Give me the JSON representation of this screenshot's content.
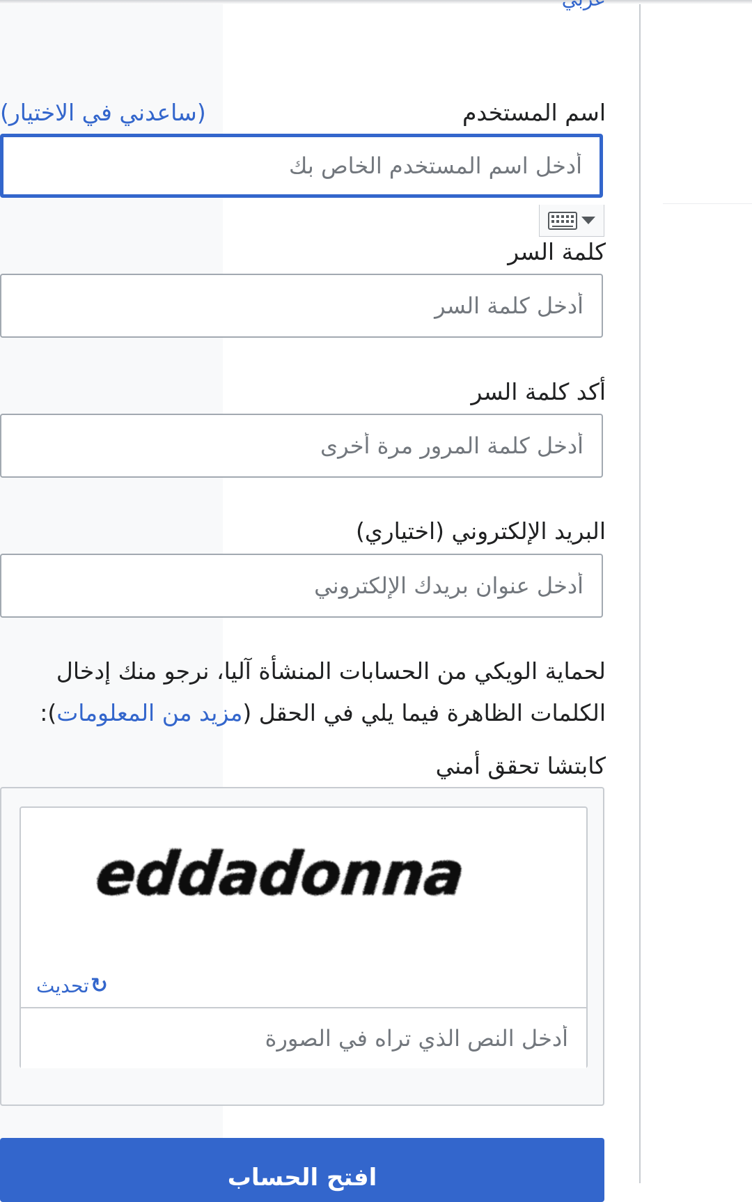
{
  "header": {
    "language_link": "عربي"
  },
  "form": {
    "username": {
      "label": "اسم المستخدم",
      "help_link": "(ساعدني في الاختيار)",
      "placeholder": "أدخل اسم المستخدم الخاص بك"
    },
    "password": {
      "label": "كلمة السر",
      "placeholder": "أدخل كلمة السر"
    },
    "confirm_password": {
      "label": "أكد كلمة السر",
      "placeholder": "أدخل كلمة المرور مرة أخرى"
    },
    "email": {
      "label": "البريد الإلكتروني (اختياري)",
      "placeholder": "أدخل عنوان بريدك الإلكتروني"
    },
    "captcha_notice": {
      "text_before": "لحماية الويكي من الحسابات المنشأة آليا، نرجو منك إدخال الكلمات الظاهرة فيما يلي في الحقل (",
      "link": "مزيد من المعلومات",
      "text_after": "):"
    },
    "captcha": {
      "label": "كابتشا تحقق أمني",
      "image_text": "eddadonna",
      "refresh_label": "تحديث",
      "placeholder": "أدخل النص الذي تراه في الصورة"
    },
    "submit_label": "افتح الحساب"
  },
  "icons": {
    "keyboard": "keyboard-icon",
    "dropdown": "caret-down-icon",
    "refresh": "refresh-icon"
  },
  "colors": {
    "accent": "#3366cc",
    "border": "#a2a9b1",
    "placeholder": "#72777d",
    "text": "#202122"
  }
}
